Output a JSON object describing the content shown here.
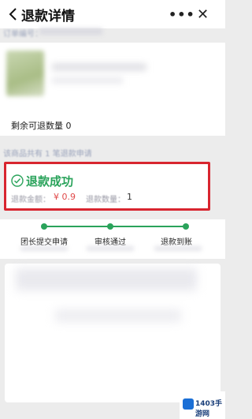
{
  "header": {
    "title": "退款详情",
    "more_icon": "more-dots-icon",
    "close_icon": "close-icon",
    "back_icon": "chevron-left-icon"
  },
  "order": {
    "order_no_label": "订单编号："
  },
  "product": {
    "remaining_refund_qty": "剩余可退数量 0"
  },
  "applied_note": "该商品共有 1 笔退款申请",
  "status": {
    "text": "退款成功",
    "amount_label": "退款金额：",
    "amount_value": "¥ 0.9",
    "qty_label": "退款数量：",
    "qty_value": "1",
    "color": "#2aa35b",
    "highlight_color": "#d8252f"
  },
  "progress": {
    "steps": [
      {
        "label": "团长提交申请"
      },
      {
        "label": "审核通过"
      },
      {
        "label": "退款到账"
      }
    ]
  },
  "watermark": {
    "text": "1403手游网"
  }
}
